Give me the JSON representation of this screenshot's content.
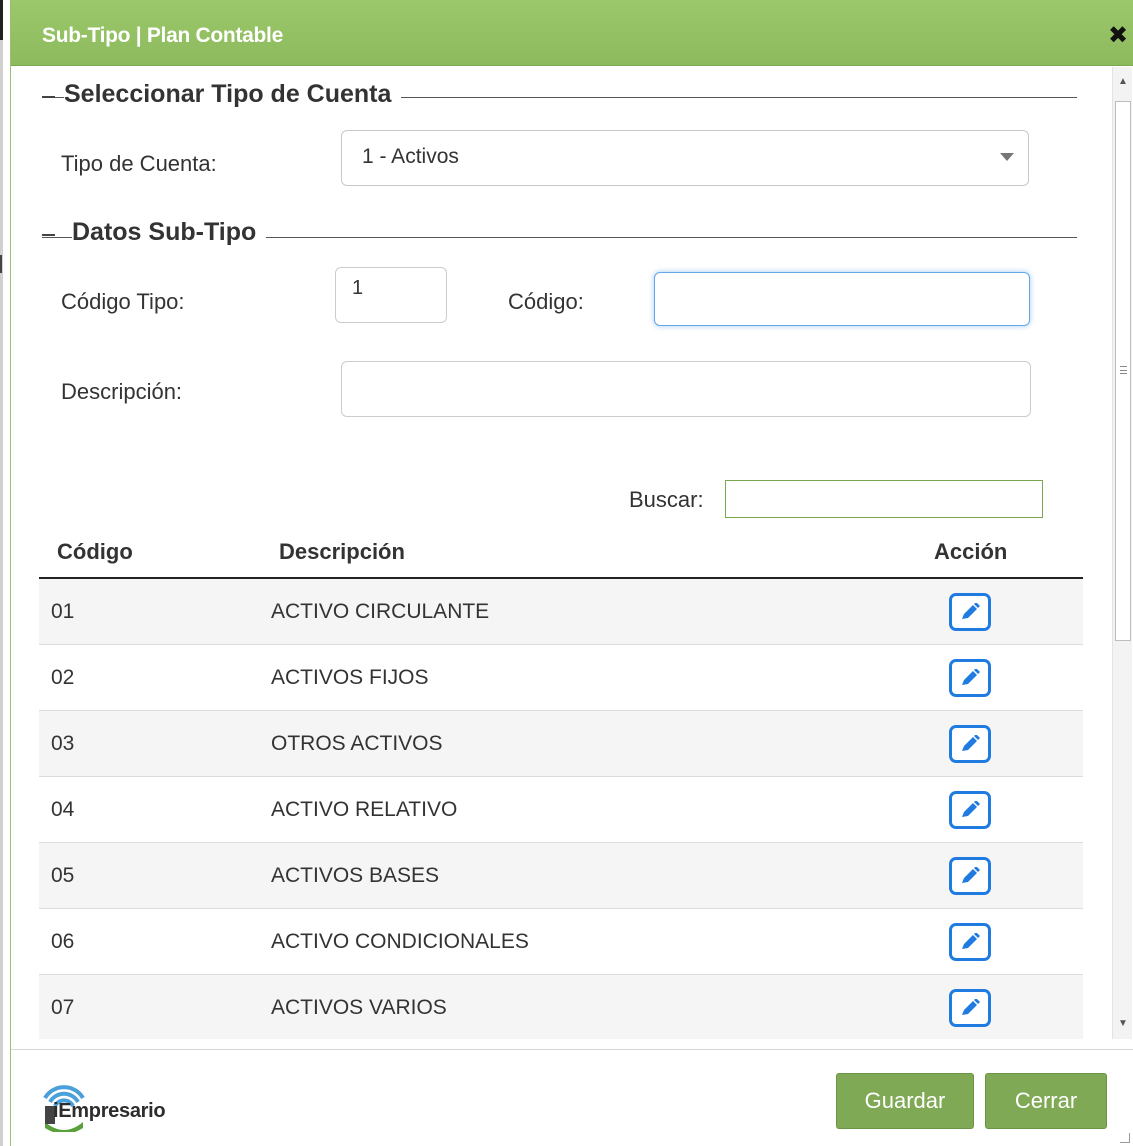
{
  "dialog": {
    "title": "Sub-Tipo | Plan Contable",
    "close_glyph": "✖"
  },
  "section_tipo": {
    "legend": "Seleccionar Tipo de Cuenta",
    "tipo_label": "Tipo de Cuenta:",
    "tipo_selected": "1 - Activos"
  },
  "section_datos": {
    "legend": "Datos Sub-Tipo",
    "codigo_tipo_label": "Código Tipo:",
    "codigo_tipo_value": "1",
    "codigo_label": "Código:",
    "codigo_value": "",
    "descripcion_label": "Descripción:",
    "descripcion_value": ""
  },
  "search": {
    "label": "Buscar:",
    "value": ""
  },
  "table": {
    "headers": [
      "Código",
      "Descripción",
      "Acción"
    ],
    "rows": [
      {
        "codigo": "01",
        "descripcion": "ACTIVO CIRCULANTE"
      },
      {
        "codigo": "02",
        "descripcion": "ACTIVOS FIJOS"
      },
      {
        "codigo": "03",
        "descripcion": "OTROS ACTIVOS"
      },
      {
        "codigo": "04",
        "descripcion": "ACTIVO RELATIVO"
      },
      {
        "codigo": "05",
        "descripcion": "ACTIVOS BASES"
      },
      {
        "codigo": "06",
        "descripcion": "ACTIVO CONDICIONALES"
      },
      {
        "codigo": "07",
        "descripcion": "ACTIVOS VARIOS"
      }
    ],
    "action_icon": "edit-pencil-icon"
  },
  "footer": {
    "logo_text": "iEmpresario",
    "guardar_label": "Guardar",
    "cerrar_label": "Cerrar"
  },
  "colors": {
    "titlebar": "#94c164",
    "button": "#7fa955",
    "edit_icon": "#1f7be0",
    "focus": "#66a7e8"
  }
}
